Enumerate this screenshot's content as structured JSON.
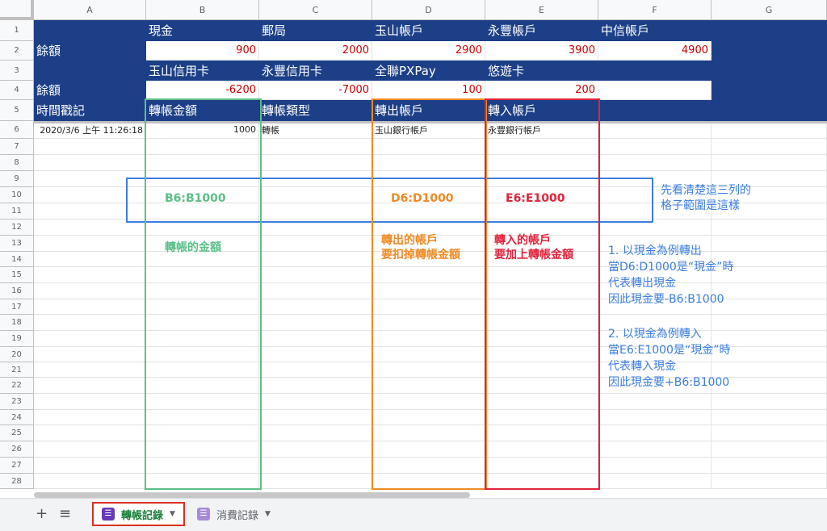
{
  "columns": [
    "A",
    "B",
    "C",
    "D",
    "E",
    "F",
    "G"
  ],
  "rows": [
    "1",
    "2",
    "3",
    "4",
    "5",
    "6",
    "7",
    "8",
    "9",
    "10",
    "11",
    "12",
    "13",
    "14",
    "15",
    "16",
    "17",
    "18",
    "19",
    "20",
    "21",
    "22",
    "23",
    "24",
    "25",
    "26",
    "27",
    "28"
  ],
  "sheet": {
    "row1": [
      "",
      "現金",
      "郵局",
      "玉山帳戶",
      "永豐帳戶",
      "中信帳戶"
    ],
    "row2": [
      "餘額",
      "900",
      "2000",
      "2900",
      "3900",
      "4900"
    ],
    "row3": [
      "",
      "玉山信用卡",
      "永豐信用卡",
      "全聯PXPay",
      "悠遊卡",
      ""
    ],
    "row4": [
      "餘額",
      "-6200",
      "-7000",
      "100",
      "200",
      ""
    ],
    "row5": [
      "時間戳記",
      "轉帳金額",
      "轉帳類型",
      "轉出帳戶",
      "轉入帳戶",
      ""
    ],
    "row6": [
      "2020/3/6 上午 11:26:18",
      "1000",
      "轉帳",
      "玉山銀行帳戶",
      "永豐銀行帳戶",
      ""
    ]
  },
  "annotations": {
    "b_range": "B6:B1000",
    "d_range": "D6:D1000",
    "e_range": "E6:E1000",
    "range_note": [
      "先看清楚這三列的",
      "格子範圍是這樣"
    ],
    "b_label": "轉帳的金額",
    "d_label": [
      "轉出的帳戶",
      "要扣掉轉帳金額"
    ],
    "e_label": [
      "轉入的帳戶",
      "要加上轉帳金額"
    ],
    "note1": [
      "1. 以現金為例轉出",
      "當D6:D1000是“現金”時",
      "代表轉出現金",
      "因此現金要-B6:B1000"
    ],
    "note2": [
      "2. 以現金為例轉入",
      "當E6:E1000是“現金”時",
      "代表轉入現金",
      "因此現金要+B6:B1000"
    ]
  },
  "tabs": {
    "add_label": "+",
    "list_label": "≡",
    "items": [
      {
        "label": "轉帳記錄",
        "active": true
      },
      {
        "label": "消費記錄",
        "active": false
      }
    ]
  },
  "colors": {
    "header_blue": "#1c3f87",
    "green": "#5bbf87",
    "orange": "#f08a24",
    "red": "#e2233b",
    "note_blue": "#3a7de0"
  }
}
